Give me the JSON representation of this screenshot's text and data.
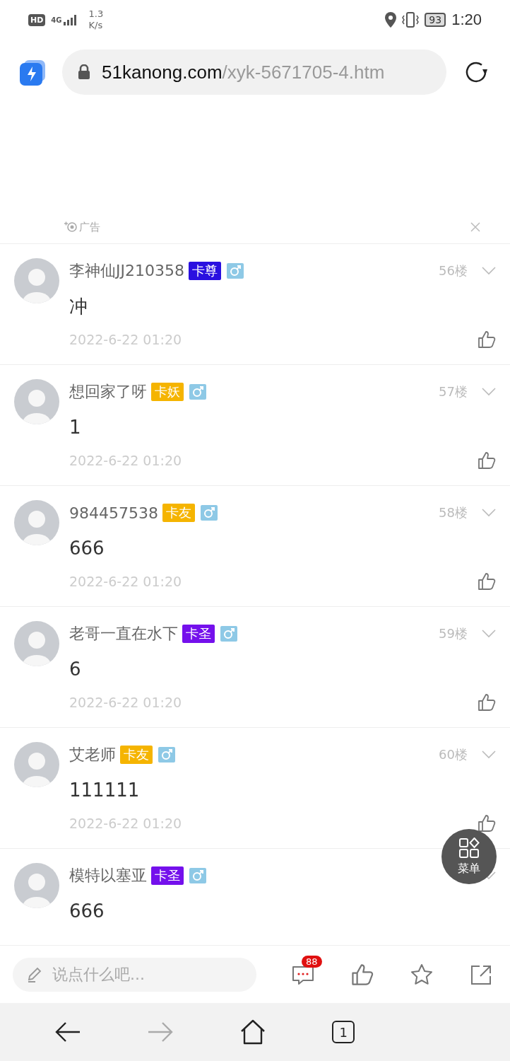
{
  "status_bar": {
    "hd": "HD",
    "network": "4G",
    "speed": "1.3",
    "speed_unit": "K/s",
    "battery": "93",
    "time": "1:20"
  },
  "address_bar": {
    "domain": "51kanong.com",
    "path": "/xyk-5671705-4.htm"
  },
  "ad": {
    "label": "广告"
  },
  "posts": [
    {
      "name": "李神仙JJ210358",
      "badge": "卡尊",
      "color": "#2a10e0",
      "male": true,
      "floor": "56楼",
      "content": "冲",
      "time": "2022-6-22 01:20"
    },
    {
      "name": "想回家了呀",
      "badge": "卡妖",
      "color": "#f5b400",
      "male": true,
      "floor": "57楼",
      "content": "1",
      "time": "2022-6-22 01:20"
    },
    {
      "name": "984457538",
      "badge": "卡友",
      "color": "#f5b400",
      "male": true,
      "floor": "58楼",
      "content": "666",
      "time": "2022-6-22 01:20"
    },
    {
      "name": "老哥一直在水下",
      "badge": "卡圣",
      "color": "#7410ec",
      "male": true,
      "floor": "59楼",
      "content": "6",
      "time": "2022-6-22 01:20"
    },
    {
      "name": "艾老师",
      "badge": "卡友",
      "color": "#f5b400",
      "male": true,
      "floor": "60楼",
      "content": "111111",
      "time": "2022-6-22 01:20"
    },
    {
      "name": "模特以塞亚",
      "badge": "卡圣",
      "color": "#7410ec",
      "male": true,
      "content": "666"
    }
  ],
  "fab": {
    "label": "菜单"
  },
  "comment_bar": {
    "placeholder": "说点什么吧...",
    "comment_count": "88"
  },
  "nav": [
    {
      "kind": "back",
      "disabled": false
    },
    {
      "kind": "forward",
      "disabled": true
    },
    {
      "kind": "home",
      "disabled": false
    },
    {
      "kind": "tabs",
      "label": "1",
      "disabled": false
    }
  ]
}
